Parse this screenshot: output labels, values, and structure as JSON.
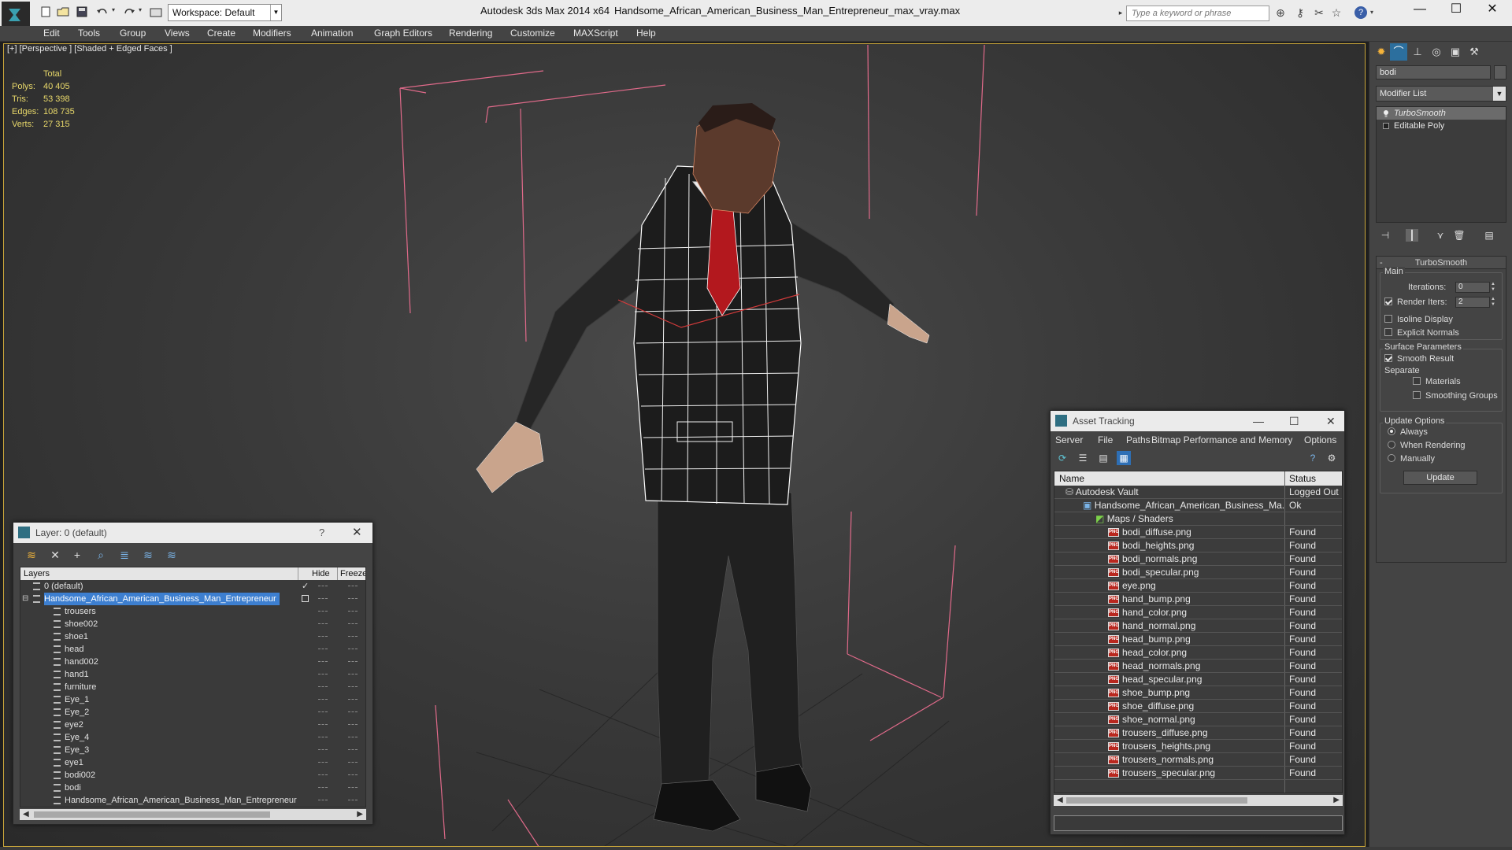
{
  "titlebar": {
    "app_title": "Autodesk 3ds Max  2014 x64",
    "file_name": "Handsome_African_American_Business_Man_Entrepreneur_max_vray.max",
    "workspace": "Workspace: Default",
    "search_placeholder": "Type a keyword or phrase",
    "minimize": "—",
    "maximize": "☐",
    "close": "✕"
  },
  "menu": [
    "Edit",
    "Tools",
    "Group",
    "Views",
    "Create",
    "Modifiers",
    "Animation",
    "Graph Editors",
    "Rendering",
    "Customize",
    "MAXScript",
    "Help"
  ],
  "viewport": {
    "label": "[+] [Perspective ] [Shaded + Edged Faces ]",
    "stats": {
      "header": "Total",
      "polys_label": "Polys:",
      "polys": "40 405",
      "tris_label": "Tris:",
      "tris": "53 398",
      "edges_label": "Edges:",
      "edges": "108 735",
      "verts_label": "Verts:",
      "verts": "27 315"
    }
  },
  "command_panel": {
    "object_name": "bodi",
    "modifier_list": "Modifier List",
    "stack": [
      "TurboSmooth",
      "Editable Poly"
    ],
    "turbosmooth": {
      "title": "TurboSmooth",
      "main": "Main",
      "iterations_label": "Iterations:",
      "iterations": "0",
      "render_iters_label": "Render Iters:",
      "render_iters": "2",
      "isoline": "Isoline Display",
      "explicit_normals": "Explicit Normals",
      "surface_params": "Surface Parameters",
      "smooth_result": "Smooth Result",
      "separate": "Separate",
      "materials": "Materials",
      "smoothing_groups": "Smoothing Groups",
      "update_options": "Update Options",
      "always": "Always",
      "when_rendering": "When Rendering",
      "manually": "Manually",
      "update_btn": "Update"
    }
  },
  "layer_dialog": {
    "title": "Layer: 0 (default)",
    "help": "?",
    "close": "✕",
    "col_layers": "Layers",
    "col_hide": "Hide",
    "col_freeze": "Freeze",
    "rows": [
      "0 (default)",
      "Handsome_African_American_Business_Man_Entrepreneur",
      "trousers",
      "shoe002",
      "shoe1",
      "head",
      "hand002",
      "hand1",
      "furniture",
      "Eye_1",
      "Eye_2",
      "eye2",
      "Eye_4",
      "Eye_3",
      "eye1",
      "bodi002",
      "bodi",
      "Handsome_African_American_Business_Man_Entrepreneur"
    ]
  },
  "asset_dialog": {
    "title": "Asset Tracking",
    "menu": [
      "Server",
      "File",
      "Paths",
      "Bitmap Performance and Memory",
      "Options"
    ],
    "col_name": "Name",
    "col_status": "Status",
    "vault": {
      "name": "Autodesk Vault",
      "status": "Logged Out"
    },
    "file": {
      "name": "Handsome_African_American_Business_Ma...",
      "status": "Ok"
    },
    "maps_group": "Maps / Shaders",
    "maps": [
      {
        "name": "bodi_diffuse.png",
        "status": "Found"
      },
      {
        "name": "bodi_heights.png",
        "status": "Found"
      },
      {
        "name": "bodi_normals.png",
        "status": "Found"
      },
      {
        "name": "bodi_specular.png",
        "status": "Found"
      },
      {
        "name": "eye.png",
        "status": "Found"
      },
      {
        "name": "hand_bump.png",
        "status": "Found"
      },
      {
        "name": "hand_color.png",
        "status": "Found"
      },
      {
        "name": "hand_normal.png",
        "status": "Found"
      },
      {
        "name": "head_bump.png",
        "status": "Found"
      },
      {
        "name": "head_color.png",
        "status": "Found"
      },
      {
        "name": "head_normals.png",
        "status": "Found"
      },
      {
        "name": "head_specular.png",
        "status": "Found"
      },
      {
        "name": "shoe_bump.png",
        "status": "Found"
      },
      {
        "name": "shoe_diffuse.png",
        "status": "Found"
      },
      {
        "name": "shoe_normal.png",
        "status": "Found"
      },
      {
        "name": "trousers_diffuse.png",
        "status": "Found"
      },
      {
        "name": "trousers_heights.png",
        "status": "Found"
      },
      {
        "name": "trousers_normals.png",
        "status": "Found"
      },
      {
        "name": "trousers_specular.png",
        "status": "Found"
      }
    ]
  },
  "colors": {
    "viewport_border": "#c9a63b",
    "stats_text": "#e8d86a",
    "selection_blue": "#3d7fd0",
    "bbox_pink": "#e06a8a"
  }
}
